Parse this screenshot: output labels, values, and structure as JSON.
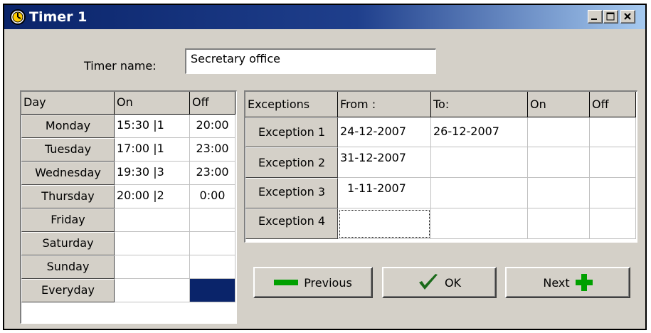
{
  "window": {
    "title": "Timer 1"
  },
  "form": {
    "timer_name_label": "Timer name:",
    "timer_name_value": "Secretary office"
  },
  "days_table": {
    "headers": [
      "Day",
      "On",
      "Off"
    ],
    "rows": [
      {
        "day": "Monday",
        "on": "15:30 |1",
        "off": "20:00"
      },
      {
        "day": "Tuesday",
        "on": "17:00 |1",
        "off": "23:00"
      },
      {
        "day": "Wednesday",
        "on": "19:30 |3",
        "off": "23:00"
      },
      {
        "day": "Thursday",
        "on": "20:00 |2",
        "off": "0:00"
      },
      {
        "day": "Friday",
        "on": "",
        "off": ""
      },
      {
        "day": "Saturday",
        "on": "",
        "off": ""
      },
      {
        "day": "Sunday",
        "on": "",
        "off": ""
      },
      {
        "day": "Everyday",
        "on": "",
        "off": ""
      }
    ]
  },
  "exceptions_table": {
    "headers": [
      "Exceptions",
      "From :",
      "To:",
      "On",
      "Off"
    ],
    "rows": [
      {
        "name": "Exception 1",
        "from": "24-12-2007",
        "to": "26-12-2007",
        "on": "",
        "off": ""
      },
      {
        "name": "Exception 2",
        "from": "31-12-2007",
        "to": "",
        "on": "",
        "off": ""
      },
      {
        "name": "Exception 3",
        "from": "1-11-2007",
        "to": "",
        "on": "",
        "off": ""
      },
      {
        "name": "Exception 4",
        "from": "",
        "to": "",
        "on": "",
        "off": ""
      }
    ]
  },
  "buttons": {
    "previous": "Previous",
    "ok": "OK",
    "next": "Next"
  },
  "colors": {
    "title_bar": "#0a246a",
    "selected_cell": "#0a246a",
    "green_icon": "#00a000"
  }
}
